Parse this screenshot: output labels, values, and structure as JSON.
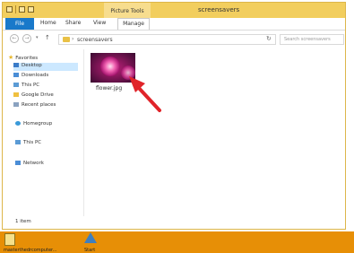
{
  "window": {
    "title": "screensavers",
    "contextual_tab": "Picture Tools"
  },
  "ribbon": {
    "tabs": [
      "File",
      "Home",
      "Share",
      "View",
      "Manage"
    ]
  },
  "address": {
    "path": "screensavers",
    "search_placeholder": "Search screensavers"
  },
  "sidebar": {
    "favorites": "Favorites",
    "items": [
      "Desktop",
      "Downloads",
      "This PC",
      "Google Drive",
      "Recent places"
    ],
    "homegroup": "Homegroup",
    "thispc": "This PC",
    "network": "Network"
  },
  "file": {
    "name": "flower.jpg"
  },
  "status": {
    "count": "1 item"
  },
  "taskbar": {
    "items": [
      "masterthedrcomputer...",
      "Start"
    ]
  },
  "colors": {
    "titlebar": "#f2ce5e",
    "file_tab": "#1979ca",
    "taskbar": "#e78f06",
    "arrow": "#e0242a"
  }
}
